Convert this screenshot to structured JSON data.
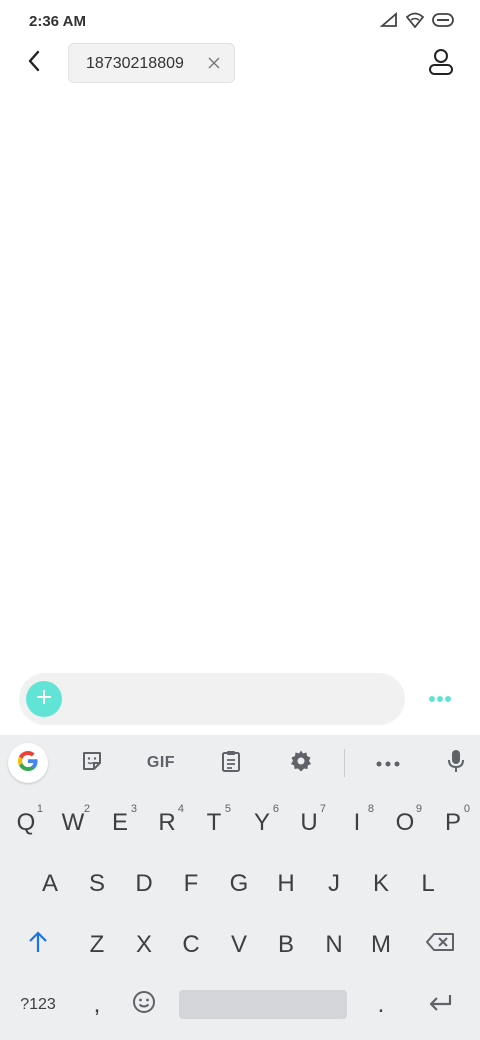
{
  "status_bar": {
    "time": "2:36 AM",
    "icons": [
      "signal-icon",
      "wifi-icon",
      "battery-icon"
    ]
  },
  "header": {
    "back_icon": "back-arrow-icon",
    "recipient": "18730218809",
    "remove_icon": "close-icon",
    "contact_icon": "contact-icon"
  },
  "compose": {
    "add_icon": "plus-icon",
    "message_value": "",
    "more_icon": "more-dots-icon",
    "accent_color": "#61e4d6"
  },
  "keyboard": {
    "toolbar": [
      "google-icon",
      "sticker-icon",
      "GIF",
      "clipboard-icon",
      "gear-icon",
      "more-icon",
      "mic-icon"
    ],
    "row1": [
      {
        "label": "Q",
        "hint": "1"
      },
      {
        "label": "W",
        "hint": "2"
      },
      {
        "label": "E",
        "hint": "3"
      },
      {
        "label": "R",
        "hint": "4"
      },
      {
        "label": "T",
        "hint": "5"
      },
      {
        "label": "Y",
        "hint": "6"
      },
      {
        "label": "U",
        "hint": "7"
      },
      {
        "label": "I",
        "hint": "8"
      },
      {
        "label": "O",
        "hint": "9"
      },
      {
        "label": "P",
        "hint": "0"
      }
    ],
    "row2": [
      "A",
      "S",
      "D",
      "F",
      "G",
      "H",
      "J",
      "K",
      "L"
    ],
    "row3": [
      "Z",
      "X",
      "C",
      "V",
      "B",
      "N",
      "M"
    ],
    "row4": {
      "symbols": "?123",
      "comma": ",",
      "period": "."
    },
    "shift_icon": "shift-arrow-icon",
    "backspace_icon": "backspace-icon",
    "emoji_icon": "emoji-icon",
    "enter_icon": "enter-icon"
  }
}
